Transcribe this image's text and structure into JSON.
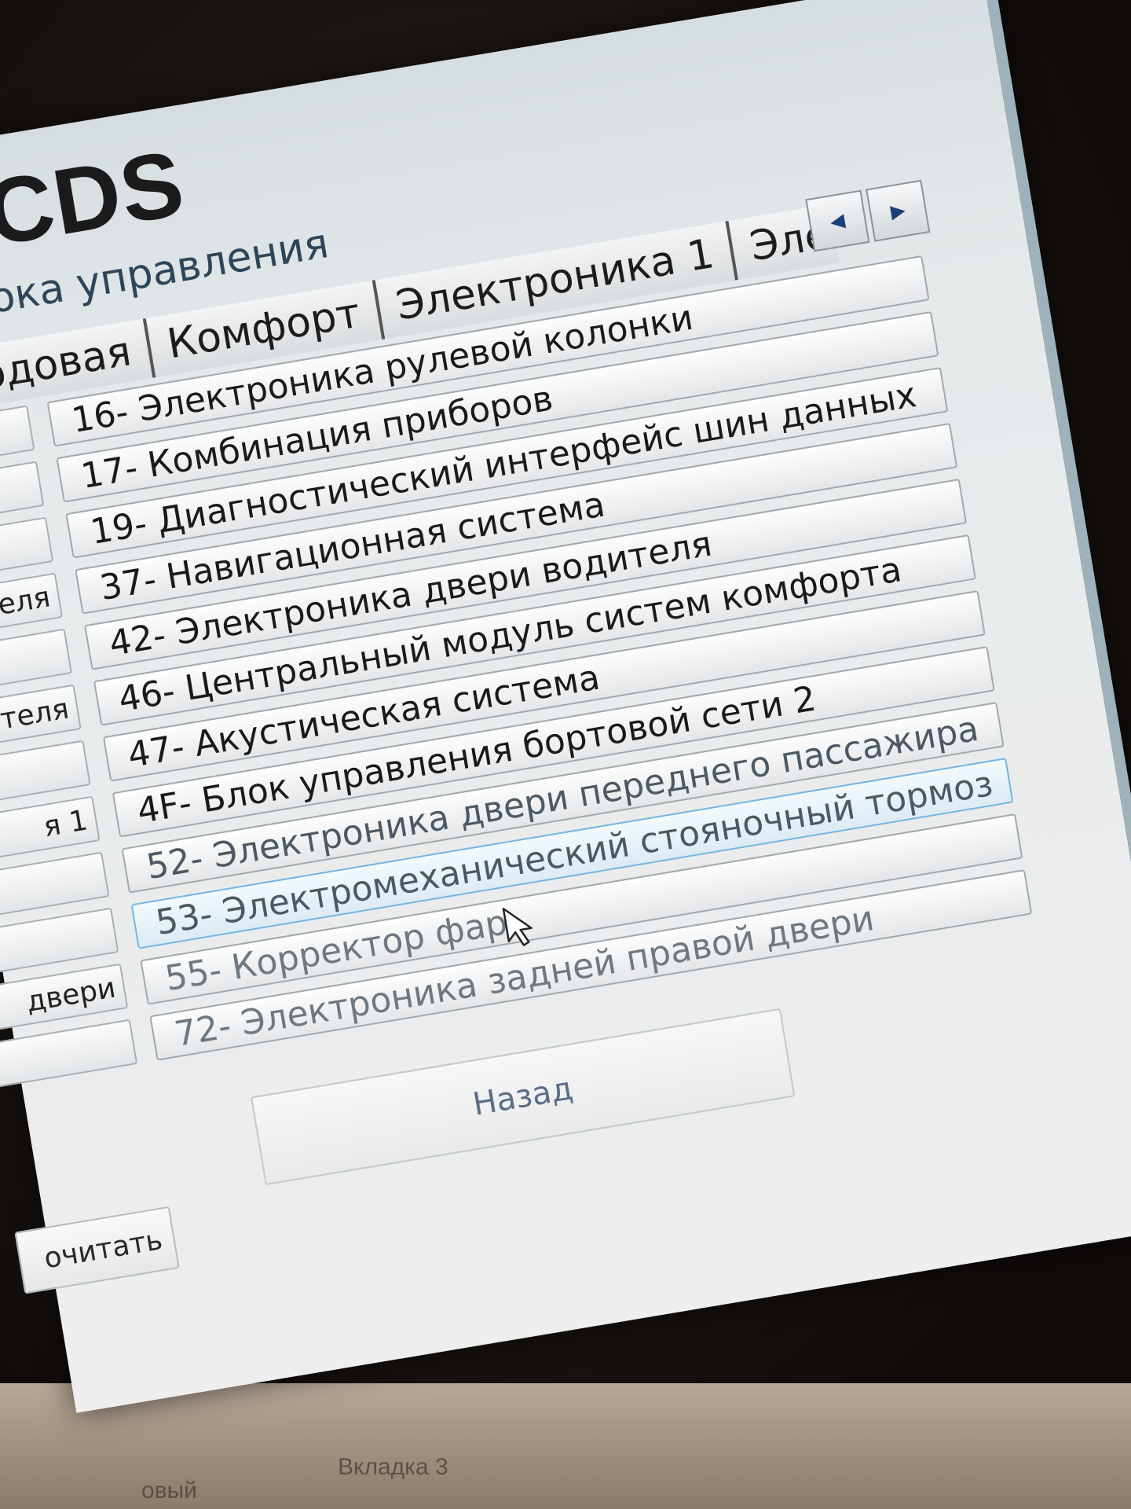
{
  "app": {
    "title": "VCDS",
    "subtitle": "блока управления"
  },
  "tabs": {
    "items": [
      {
        "label": "д"
      },
      {
        "label": "Ходовая"
      },
      {
        "label": "Комфорт"
      },
      {
        "label": "Электроника 1"
      },
      {
        "label": "Электр"
      }
    ],
    "scroll_left": "◀",
    "scroll_right": "▶"
  },
  "left_column": {
    "items": [
      {
        "label": ""
      },
      {
        "label": ""
      },
      {
        "label": ""
      },
      {
        "label": "вигателя"
      },
      {
        "label": ""
      },
      {
        "label": "лителя"
      },
      {
        "label": ""
      },
      {
        "label": "я 1"
      },
      {
        "label": ""
      },
      {
        "label": ""
      },
      {
        "label": "двери"
      },
      {
        "label": ""
      }
    ]
  },
  "modules": {
    "items": [
      {
        "label": "16- Электроника рулевой колонки"
      },
      {
        "label": "17- Комбинация приборов"
      },
      {
        "label": "19- Диагностический интерфейс шин данных"
      },
      {
        "label": "37- Навигационная система"
      },
      {
        "label": "42- Электроника двери водителя"
      },
      {
        "label": "46- Центральный модуль систем комфорта"
      },
      {
        "label": "47- Акустическая система"
      },
      {
        "label": "4F- Блок управления бортовой сети 2"
      },
      {
        "label": "52- Электроника двери переднего пассажира"
      },
      {
        "label": "53- Электромеханический стояночный тормоз"
      },
      {
        "label": "55- Корректор фар"
      },
      {
        "label": "72- Электроника задней правой двери"
      }
    ]
  },
  "buttons": {
    "back": "Назад",
    "read": "очитать"
  },
  "taskbar": {
    "label_1": "овый",
    "label_2": "Вкладка 3"
  }
}
